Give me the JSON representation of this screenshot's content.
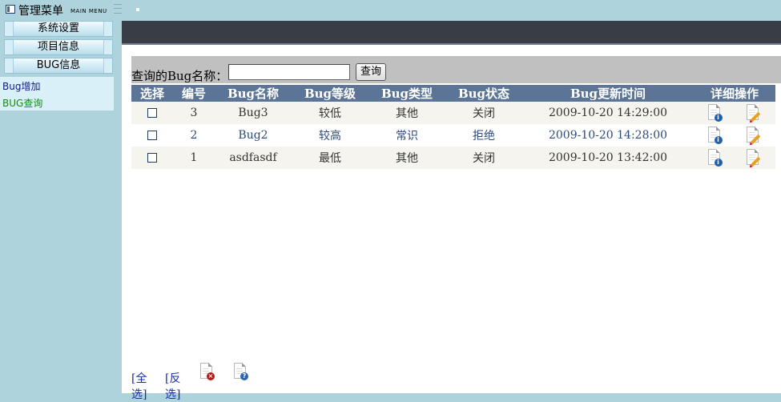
{
  "topbar": {
    "title": "管理菜单",
    "subtitle": "MAIN MENU"
  },
  "sidebar": {
    "items": [
      {
        "label": "系统设置"
      },
      {
        "label": "项目信息"
      },
      {
        "label": "BUG信息"
      }
    ],
    "submenu": [
      {
        "label": "Bug增加",
        "color": "#0a1a8a"
      },
      {
        "label": "BUG查询",
        "color": "#138a13"
      }
    ]
  },
  "search": {
    "label": "查询的Bug名称：",
    "value": "",
    "button": "查询"
  },
  "table": {
    "headers": [
      "选择",
      "编号",
      "Bug名称",
      "Bug等级",
      "Bug类型",
      "Bug状态",
      "Bug更新时间",
      "详细操作"
    ],
    "rows": [
      {
        "id": "3",
        "name": "Bug3",
        "level": "较低",
        "type": "其他",
        "status": "关闭",
        "updated": "2009-10-20 14:29:00"
      },
      {
        "id": "2",
        "name": "Bug2",
        "level": "较高",
        "type": "常识",
        "status": "拒绝",
        "updated": "2009-10-20 14:28:00"
      },
      {
        "id": "1",
        "name": "asdfasdf",
        "level": "最低",
        "type": "其他",
        "status": "关闭",
        "updated": "2009-10-20 13:42:00"
      }
    ]
  },
  "footer": {
    "select_all": "[全选]",
    "invert": "[反选]"
  },
  "colors": {
    "background": "#aed3dc",
    "header_bar": "#393d45",
    "table_header": "#5c7596",
    "row_alt": "#f6f4ee"
  }
}
